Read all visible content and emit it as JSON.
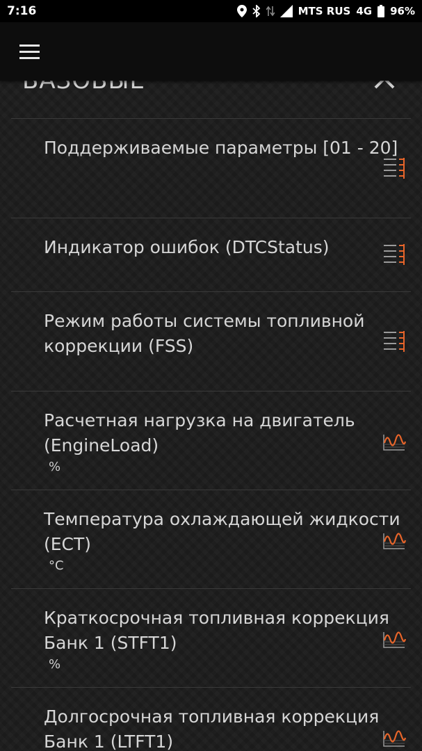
{
  "status_bar": {
    "time": "7:16",
    "carrier": "MTS RUS",
    "network": "4G",
    "battery": "96%",
    "icons": [
      "location-icon",
      "bluetooth-icon",
      "data-arrows-icon",
      "signal-icon"
    ]
  },
  "app_bar": {
    "menu_icon": "hamburger-menu-icon"
  },
  "section": {
    "title": "БАЗОВЫЕ",
    "collapse_icon": "close-icon"
  },
  "colors": {
    "accent": "#e8652a",
    "text": "#d6d6d6",
    "divider": "#3a3a3a",
    "background": "#1b1b1b"
  },
  "items": [
    {
      "label": "Поддерживаемые параметры [01 - 20]",
      "unit": "",
      "icon": "bitmask-list-icon"
    },
    {
      "label": "Индикатор ошибок (DTCStatus)",
      "unit": "",
      "icon": "bitmask-list-icon"
    },
    {
      "label": "Режим работы системы топливной коррекции (FSS)",
      "unit": "",
      "icon": "bitmask-list-icon"
    },
    {
      "label": "Расчетная нагрузка на двигатель (EngineLoad)",
      "unit": "%",
      "icon": "waveform-graph-icon"
    },
    {
      "label": "Температура охлаждающей жидкости (ECT)",
      "unit": "°C",
      "icon": "waveform-graph-icon"
    },
    {
      "label": "Краткосрочная топливная коррекция Банк 1 (STFT1)",
      "unit": "%",
      "icon": "waveform-graph-icon"
    },
    {
      "label": "Долгосрочная топливная коррекция Банк 1 (LTFT1)",
      "unit": "",
      "icon": "waveform-graph-icon"
    }
  ]
}
